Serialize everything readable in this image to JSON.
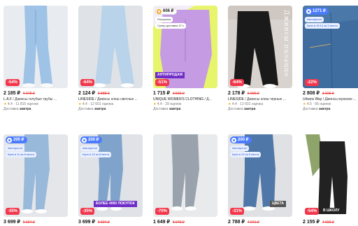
{
  "products": [
    {
      "photo": "light-blue-wide-jeans",
      "discount": "-54%",
      "price": "2 185 ₽",
      "old_price": "6 078 ₽",
      "brand": "L.A.F",
      "name": " / Джинсы голубые трубы ...",
      "rating": "4.4",
      "reviews": "11 815 оценок",
      "delivery_label": "Доставка",
      "delivery_day": "завтра"
    },
    {
      "photo": "light-wide-jeans",
      "discount": "-64%",
      "price": "2 124 ₽",
      "old_price": "5 888 ₽",
      "brand": "LINESIDE",
      "name": " / Джинсы клеш светлые ...",
      "rating": "4.4",
      "reviews": "12 601 оценка",
      "delivery_label": "Доставка",
      "delivery_day": "завтра"
    },
    {
      "photo": "lilac-jeans",
      "bonus": "606 ₽",
      "tag1": "Рассрочка",
      "tag2": "Супер доставка 37 с",
      "strip": "АНТИПРОДАЖ",
      "discount": "-51%",
      "price": "1 715 ₽",
      "old_price": "3 590 ₽",
      "brand": "UNIQUE WOMEN'S CLOTHING",
      "name": " / Д...",
      "rating": "4.4",
      "reviews": "29 оценок",
      "delivery_label": "Доставка",
      "delivery_day": "завтра"
    },
    {
      "photo": "black-wide-jeans",
      "vertical_text": "Джинсы палаццо",
      "discount": "-64%",
      "price": "2 178 ₽",
      "old_price": "5 990 ₽",
      "brand": "LINESIDE",
      "name": " / Джинсы клеш черные ...",
      "rating": "4.4",
      "reviews": "12 601 оценка",
      "delivery_label": "Доставка",
      "delivery_day": "завтра"
    },
    {
      "photo": "blue-jeans-closeup",
      "bonus": "1271 ₽",
      "tag1": "Автопрогон",
      "tag2": "Купи в 19:14 за 3 места",
      "discount": "-22%",
      "price": "2 808 ₽",
      "old_price": "3 600 ₽",
      "brand": "Urbans Way",
      "name": " / Джинсы мужские ...",
      "rating": "4.5",
      "reviews": "56 оценок",
      "delivery_label": "Доставка",
      "delivery_day": "завтра"
    },
    {
      "photo": "light-slim-jeans",
      "bonus": "200 ₽",
      "tag1": "Автопрогон",
      "tag2": "Купи в 11 за 8 места",
      "discount": "-35%",
      "price": "3 699 ₽",
      "old_price": "5 694 ₽"
    },
    {
      "photo": "blue-slim-jeans",
      "bonus": "200 ₽",
      "tag1": "Автопрогон",
      "tag2": "Купи в 13 за 8 места",
      "strip": "БОЛЕЕ 4000 ПОКУПОК",
      "discount": "-35%",
      "price": "3 699 ₽",
      "old_price": "5 694 ₽"
    },
    {
      "photo": "grey-skinny-jeans",
      "discount": "-70%",
      "price": "1 649 ₽",
      "old_price": "5 640 ₽"
    },
    {
      "photo": "blue-straight-jeans",
      "bonus": "200 ₽",
      "tag1": "Автопрогон",
      "tag2": "Купи в 13 за 8 места",
      "strip": "ЦВЕТА",
      "discount": "-31%",
      "price": "2 788 ₽",
      "old_price": "4 041 ₽"
    },
    {
      "photo": "black-straight-jeans",
      "corner_text": "В ШКОЛУ",
      "discount": "-54%",
      "price": "2 155 ₽",
      "old_price": "4 690 ₽"
    }
  ]
}
